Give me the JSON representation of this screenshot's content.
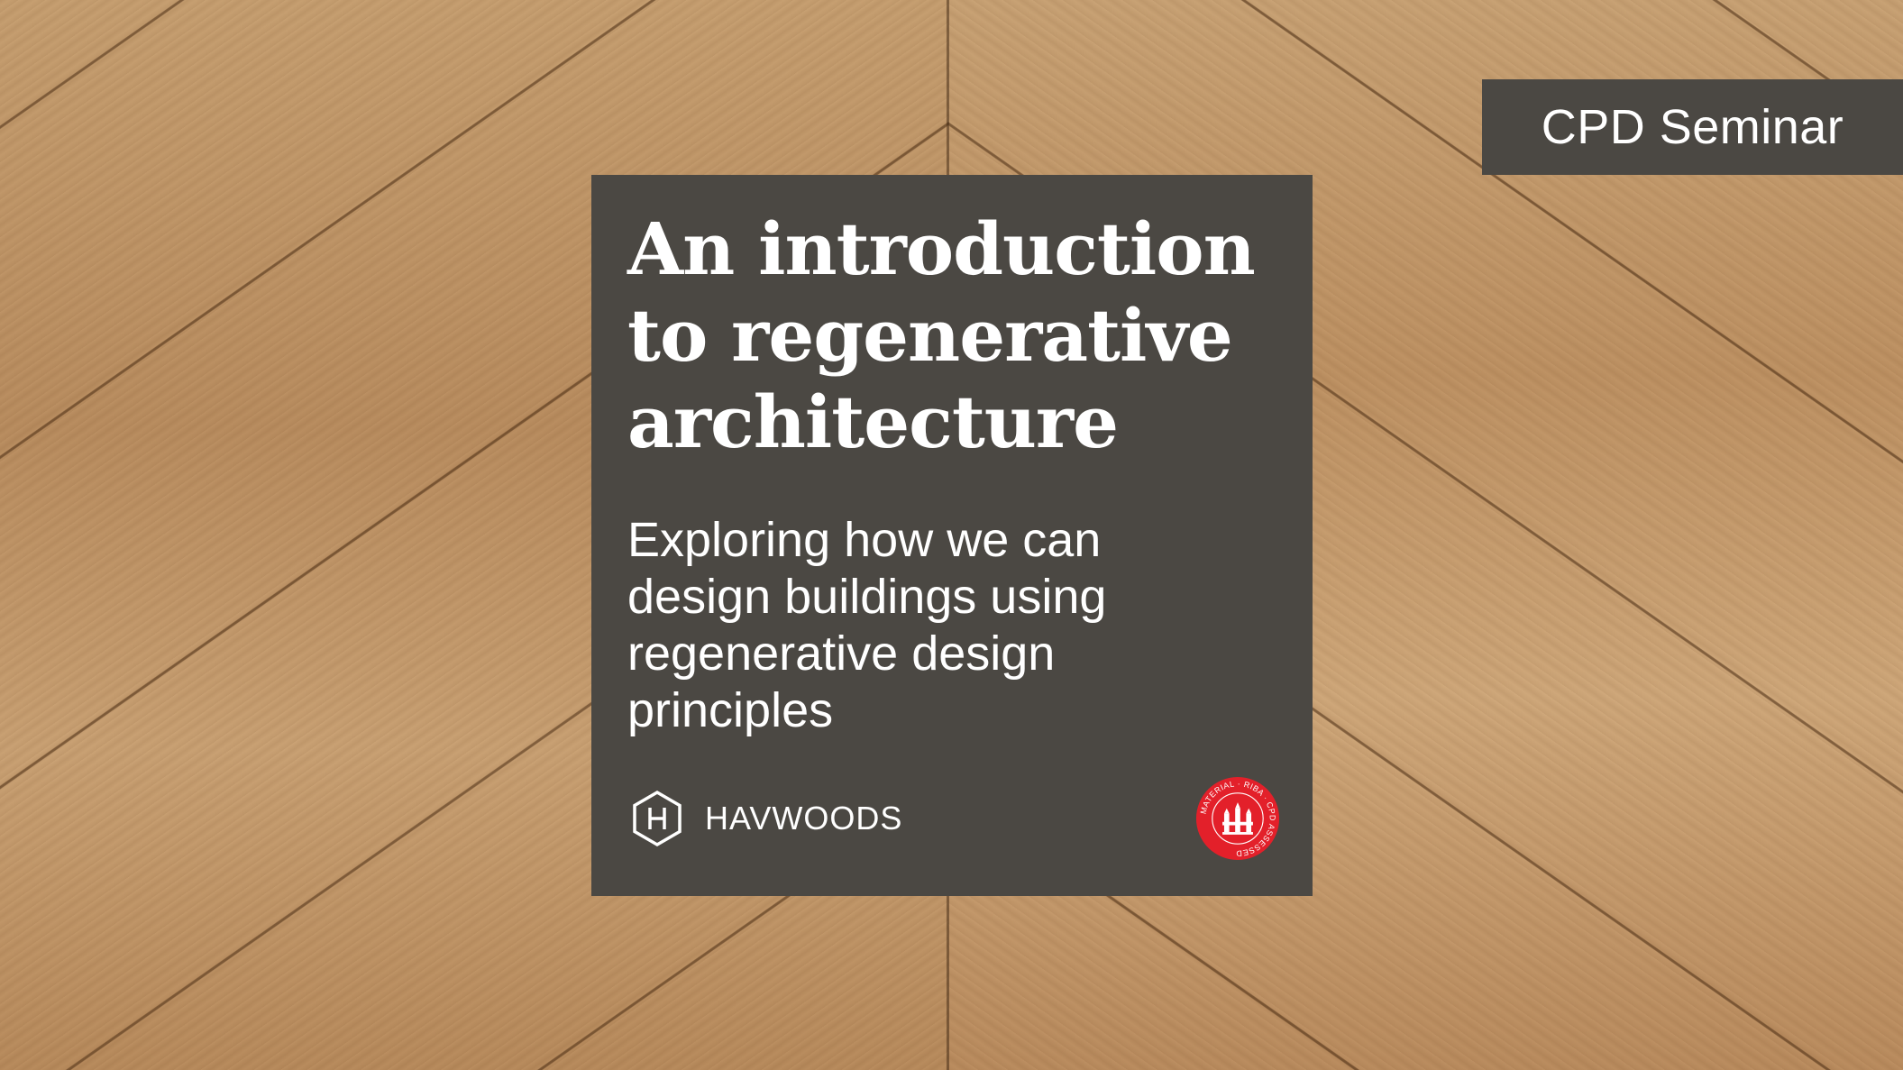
{
  "tag": {
    "label": "CPD Seminar"
  },
  "card": {
    "title": "An introduction to regenerative architecture",
    "subtitle": "Exploring how we can design buildings using regenerative design principles",
    "brand": {
      "name": "HAVWOODS",
      "icon": "hexagon-h-logo-icon"
    },
    "badge": {
      "text": "MATERIAL · RIBA · CPD ASSESSED",
      "icon": "riba-cpd-assessed-badge"
    }
  },
  "colors": {
    "panel": "#4b4843",
    "text": "#ffffff",
    "badge_red": "#e3202a",
    "wood": "#c19a6b"
  }
}
